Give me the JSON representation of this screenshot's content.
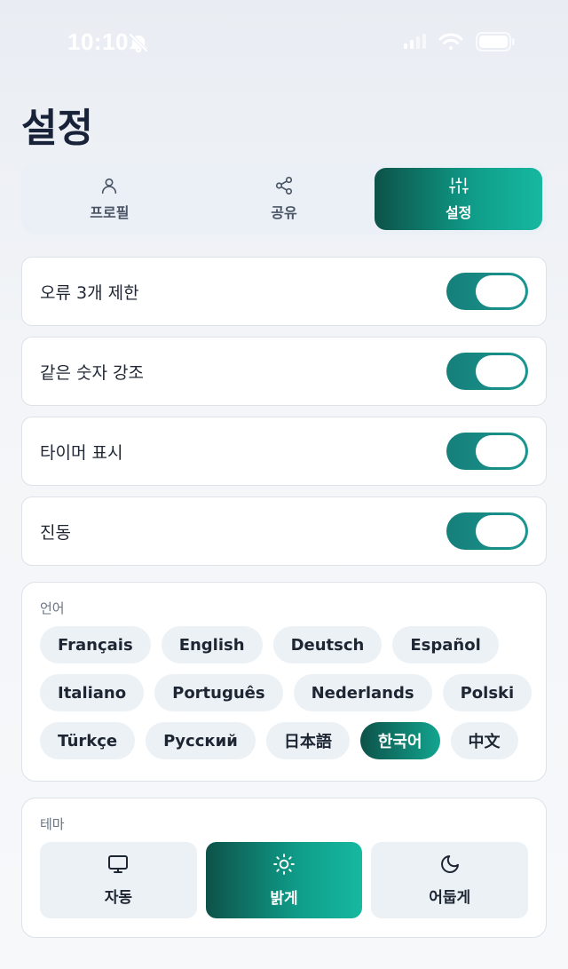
{
  "status_bar": {
    "time": "10:10",
    "icons": [
      "bell-slash-icon",
      "cellular-signal-icon",
      "wifi-icon",
      "battery-icon"
    ]
  },
  "page": {
    "title": "설정"
  },
  "tabs": [
    {
      "label": "프로필",
      "icon": "person-icon",
      "active": false
    },
    {
      "label": "공유",
      "icon": "share-icon",
      "active": false
    },
    {
      "label": "설정",
      "icon": "sliders-icon",
      "active": true
    }
  ],
  "settings": [
    {
      "label": "오류 3개 제한",
      "enabled": true
    },
    {
      "label": "같은 숫자 강조",
      "enabled": true
    },
    {
      "label": "타이머 표시",
      "enabled": true
    },
    {
      "label": "진동",
      "enabled": true
    }
  ],
  "language": {
    "title": "언어",
    "rows": [
      [
        "Français",
        "English",
        "Deutsch",
        "Español"
      ],
      [
        "Italiano",
        "Português",
        "Nederlands",
        "Polski"
      ],
      [
        "Türkçe",
        "Русский",
        "日本語",
        "한국어",
        "中文"
      ]
    ],
    "selected": "한국어"
  },
  "theme": {
    "title": "테마",
    "options": [
      {
        "label": "자동",
        "icon": "monitor-icon",
        "active": false
      },
      {
        "label": "밝게",
        "icon": "sun-icon",
        "active": true
      },
      {
        "label": "어둡게",
        "icon": "moon-icon",
        "active": false
      }
    ]
  },
  "colors": {
    "accent_start": "#0d5249",
    "accent_end": "#17b8a0",
    "toggle_on": "#167f7a"
  }
}
